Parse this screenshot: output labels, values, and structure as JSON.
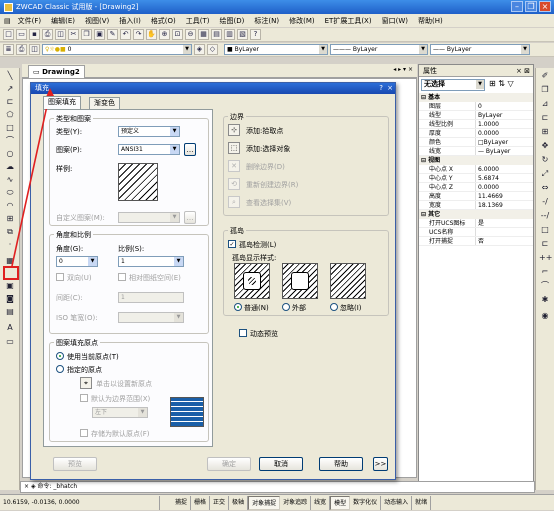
{
  "app": {
    "title": "ZWCAD Classic 试用版 - [Drawing2]",
    "menus": [
      "文件(F)",
      "编辑(E)",
      "视图(V)",
      "插入(I)",
      "格式(O)",
      "工具(T)",
      "绘图(D)",
      "标注(N)",
      "修改(M)",
      "ET扩展工具(X)",
      "窗口(W)",
      "帮助(H)"
    ],
    "layer_name": "0",
    "bylayer_color": "ByLayer",
    "bylayer_linetype": "ByLayer",
    "bylayer_lineweight": "ByLayer",
    "drawing_tab": "Drawing2"
  },
  "properties": {
    "title": "属性",
    "selection": "无选择",
    "categories": {
      "basic": "基本",
      "view": "视图",
      "other": "其它"
    },
    "basic_rows": [
      {
        "k": "图层",
        "v": "0"
      },
      {
        "k": "线型",
        "v": "ByLayer"
      },
      {
        "k": "线型比例",
        "v": "1.0000"
      },
      {
        "k": "厚度",
        "v": "0.0000"
      },
      {
        "k": "颜色",
        "v": "□ByLayer"
      },
      {
        "k": "线宽",
        "v": "— ByLayer"
      }
    ],
    "view_rows": [
      {
        "k": "中心点 X",
        "v": "6.0000"
      },
      {
        "k": "中心点 Y",
        "v": "5.6874"
      },
      {
        "k": "中心点 Z",
        "v": "0.0000"
      },
      {
        "k": "高度",
        "v": "11.4669"
      },
      {
        "k": "宽度",
        "v": "18.1369"
      }
    ],
    "other_rows": [
      {
        "k": "打开UCS图标",
        "v": "是"
      },
      {
        "k": "UCS名称",
        "v": ""
      },
      {
        "k": "打开捕捉",
        "v": "否"
      }
    ]
  },
  "dialog": {
    "title": "填充",
    "help": "?",
    "close": "×",
    "tabs": [
      "图案填充",
      "渐变色"
    ],
    "type_group": "类型和图案",
    "type_label": "类型(Y):",
    "type_value": "预定义",
    "pattern_label": "图案(P):",
    "pattern_value": "ANSI31",
    "swatch_label": "样例:",
    "custom_label": "自定义图案(M):",
    "angle_group": "角度和比例",
    "angle_label": "角度(G):",
    "angle_value": "0",
    "scale_label": "比例(S):",
    "scale_value": "1",
    "double_label": "双向(U)",
    "relative_label": "相对图纸空间(E)",
    "spacing_label": "间距(C):",
    "spacing_value": "1",
    "iso_label": "ISO 笔宽(O):",
    "origin_group": "图案填充原点",
    "use_current_origin": "使用当前原点(T)",
    "specified_origin": "指定的原点",
    "click_set_origin": "单击以设置新原点",
    "default_extent": "默认为边界范围(X)",
    "extent_value": "左下",
    "store_default": "存储为默认原点(F)",
    "boundary_group": "边界",
    "add_pick": "添加:拾取点",
    "add_select": "添加:选择对象",
    "remove_boundary": "删除边界(D)",
    "recreate_boundary": "重新创建边界(R)",
    "view_selection": "查看选择集(V)",
    "islands_group": "孤岛",
    "island_detect": "孤岛检测(L)",
    "island_style_label": "孤岛显示样式:",
    "island_styles": [
      "普通(N)",
      "外部",
      "忽略(I)"
    ],
    "dynamic_preview": "动态预览",
    "preview_btn": "预览",
    "ok_btn": "确定",
    "cancel_btn": "取消",
    "help_btn": "帮助",
    "more_btn": ">>"
  },
  "command": {
    "prompt": "命令: _bhatch"
  },
  "status": {
    "coords": "10.6159, -0.0136, 0.0000",
    "buttons": [
      "捕捉",
      "栅格",
      "正交",
      "极轴",
      "对象捕捉",
      "对象追踪",
      "线宽",
      "模型",
      "数字化仪",
      "动态输入",
      "就绪"
    ]
  },
  "colors": {
    "title_blue": "#1f5fc8",
    "highlight_red": "#e02020"
  }
}
